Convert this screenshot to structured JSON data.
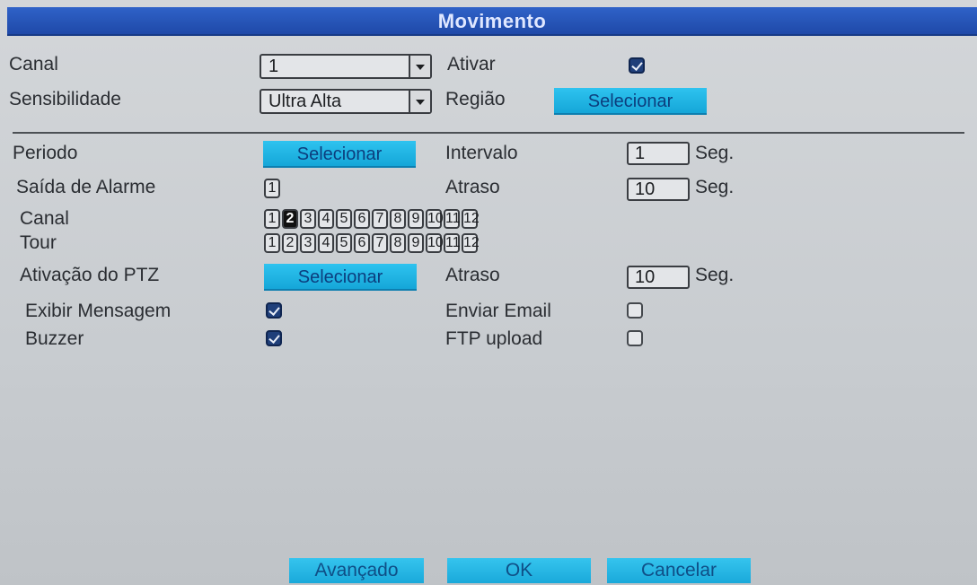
{
  "window": {
    "title": "Movimento"
  },
  "general": {
    "canal_label": "Canal",
    "canal_value": "1",
    "ativar_label": "Ativar",
    "ativar_checked": true,
    "sensibilidade_label": "Sensibilidade",
    "sensibilidade_value": "Ultra Alta",
    "regiao_label": "Região",
    "regiao_button": "Selecionar"
  },
  "settings": {
    "periodo_label": "Periodo",
    "periodo_button": "Selecionar",
    "intervalo_label": "Intervalo",
    "intervalo_value": "1",
    "intervalo_unit": "Seg.",
    "saida_label": "Saída de Alarme",
    "saida_value": "1",
    "atraso1_label": "Atraso",
    "atraso1_value": "10",
    "atraso1_unit": "Seg.",
    "canal_label": "Canal",
    "canal_numbers": [
      "1",
      "2",
      "3",
      "4",
      "5",
      "6",
      "7",
      "8",
      "9",
      "10",
      "11",
      "12"
    ],
    "canal_selected": "2",
    "tour_label": "Tour",
    "tour_numbers": [
      "1",
      "2",
      "3",
      "4",
      "5",
      "6",
      "7",
      "8",
      "9",
      "10",
      "11",
      "12"
    ],
    "ptz_label": "Ativação do PTZ",
    "ptz_button": "Selecionar",
    "atraso2_label": "Atraso",
    "atraso2_value": "10",
    "atraso2_unit": "Seg.",
    "exibir_label": "Exibir Mensagem",
    "exibir_checked": true,
    "email_label": "Enviar Email",
    "email_checked": false,
    "buzzer_label": "Buzzer",
    "buzzer_checked": true,
    "ftp_label": "FTP upload",
    "ftp_checked": false
  },
  "footer": {
    "advanced_label": "Avançado",
    "ok_label": "OK",
    "cancel_label": "Cancelar"
  }
}
